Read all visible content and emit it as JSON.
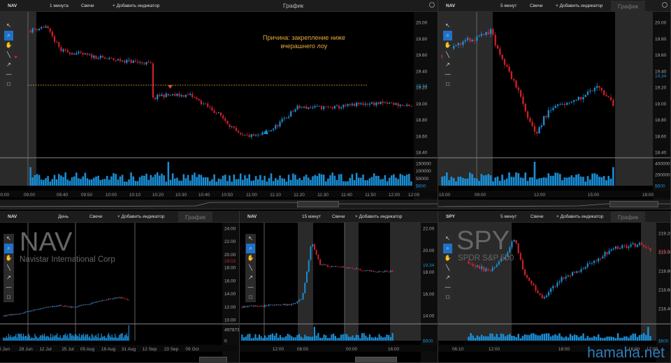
{
  "watermark": "hamaha.net",
  "panels": [
    {
      "symbol": "NAV",
      "timeframe": "1 минута",
      "chart_type": "Свечи",
      "add_indicator": "+ Добавить индикатор",
      "window_title": "График",
      "price_axis": [
        "20.00",
        "19.80",
        "19.60",
        "19.40",
        "19.20",
        "19.00",
        "18.80",
        "18.60",
        "18.40"
      ],
      "current_price": "19.34",
      "volume_axis": [
        "150000",
        "100000",
        "50000",
        "$600"
      ],
      "time_axis": [
        "00:00",
        "09:00",
        "09:40",
        "09:50",
        "10:00",
        "10:10",
        "10:20",
        "10:30",
        "10:40",
        "10:50",
        "11:00",
        "11:10",
        "11:20",
        "11:30",
        "11:40",
        "11:50",
        "12:00",
        "12:09"
      ],
      "annotation_line1": "Причина: закрепление ниже",
      "annotation_line2": "вчерашнего лоу"
    },
    {
      "symbol": "NAV",
      "timeframe": "5 минут",
      "chart_type": "Свечи",
      "add_indicator": "+ Добавить индикатор",
      "window_title": "График",
      "price_axis": [
        "20.00",
        "19.80",
        "19.60",
        "19.40",
        "19.20",
        "19.00",
        "18.80",
        "18.60",
        "18.40"
      ],
      "current_price": "19.34",
      "volume_axis": [
        "400000",
        "200000",
        "$600"
      ],
      "time_axis": [
        "15:00",
        "09:00",
        "12:00",
        "15:00",
        "18:00"
      ]
    },
    {
      "symbol": "NAV",
      "timeframe": "День",
      "chart_type": "Свечи",
      "add_indicator": "+ Добавить индикатор",
      "window_title": "График",
      "watermark_symbol": "NAV",
      "watermark_name": "Navistar International Corp",
      "price_axis": [
        "24.00",
        "22.00",
        "20.00",
        "18.00",
        "16.00",
        "14.00",
        "12.00",
        "10.00"
      ],
      "current_price": "19.02",
      "volume_axis": [
        "4978739",
        "0"
      ],
      "time_axis": [
        "0 Jun",
        "28 Jun",
        "12 Jul",
        "25 Jul",
        "05 Aug",
        "18 Aug",
        "31 Aug",
        "12 Sep",
        "23 Sep",
        "09 Oct"
      ]
    },
    {
      "symbol": "NAV",
      "timeframe": "15 минут",
      "chart_type": "Свечи",
      "add_indicator": "+ Добавить индикатор",
      "price_axis": [
        "22.00",
        "20.00",
        "18.00",
        "16.00",
        "14.00"
      ],
      "current_price": "19.34",
      "volume_axis": [
        "$600"
      ],
      "time_axis": [
        "12:00",
        "08:00",
        "00:00",
        "16:00"
      ]
    },
    {
      "symbol": "SPY",
      "timeframe": "5 минут",
      "chart_type": "Свечи",
      "add_indicator": "+ Добавить индикатор",
      "window_title": "График",
      "watermark_symbol": "SPY",
      "watermark_name": "SPDR S&P 500",
      "price_axis": [
        "219.20",
        "219.00",
        "218.80",
        "218.60",
        "218.40"
      ],
      "current_price": "219.0",
      "volume_axis": [
        "$600"
      ],
      "time_axis": [
        "06:10",
        "12:00",
        "18:00",
        "16:00",
        "17:00"
      ]
    }
  ],
  "tools": [
    "pointer-icon",
    "zoom-icon",
    "hand-icon",
    "line-icon",
    "arrow-icon",
    "hline-icon",
    "rect-icon"
  ],
  "colors": {
    "up": "#1a8fd6",
    "down": "#d0202a",
    "background": "#000000",
    "session_shade": "#2a2a2a",
    "annotation": "#e8a93a",
    "volume": "#1a8fd6"
  }
}
